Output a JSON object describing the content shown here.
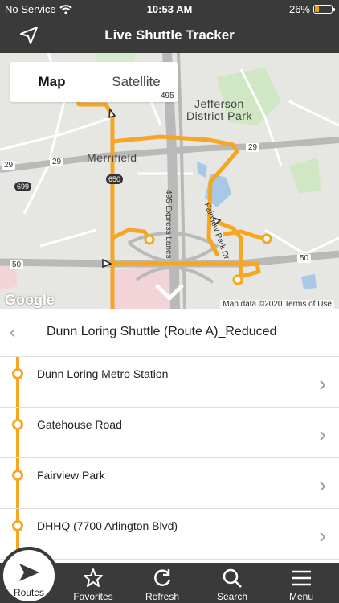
{
  "status_bar": {
    "carrier": "No Service",
    "time": "10:53 AM",
    "battery": "26%",
    "battery_level": 0.26
  },
  "nav": {
    "title": "Live Shuttle Tracker",
    "locate_icon": "location-arrow-icon"
  },
  "map": {
    "tabs": [
      {
        "label": "Map",
        "active": true
      },
      {
        "label": "Satellite",
        "active": false
      }
    ],
    "labels": {
      "jefferson": "Jefferson",
      "district_park": "District Park",
      "merrifield": "Merrifield",
      "express_lanes": "495 Express Lanes",
      "fairview": "Fairview Park Dr",
      "route_495": "495",
      "route_29a": "29",
      "route_29b": "29",
      "route_29c": "29",
      "route_699": "699",
      "route_650": "650",
      "route_50a": "50",
      "route_50b": "50"
    },
    "google": "Google",
    "map_data": "Map data ©2020   Terms of Use",
    "route_color": "#f5a623"
  },
  "route": {
    "back_icon": "chevron-left-icon",
    "name": "Dunn Loring Shuttle (Route A)_Reduced"
  },
  "stops": [
    {
      "label": "Dunn Loring Metro Station"
    },
    {
      "label": "Gatehouse Road"
    },
    {
      "label": "Fairview Park"
    },
    {
      "label": "DHHQ (7700 Arlington Blvd)"
    }
  ],
  "tab_bar": {
    "routes": {
      "label": "Routes",
      "icon": "navigation-arrow-icon"
    },
    "favorites": {
      "label": "Favorites",
      "icon": "star-icon"
    },
    "refresh": {
      "label": "Refresh",
      "icon": "refresh-icon"
    },
    "search": {
      "label": "Search",
      "icon": "search-icon"
    },
    "menu": {
      "label": "Menu",
      "icon": "menu-icon"
    }
  }
}
